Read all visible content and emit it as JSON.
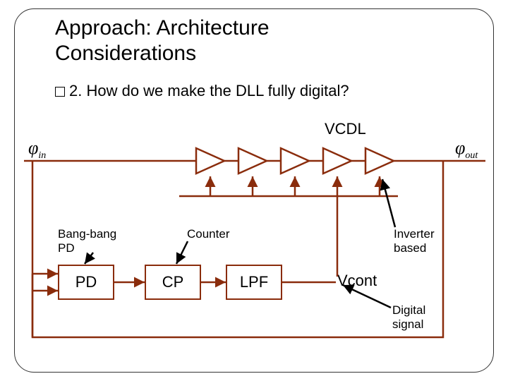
{
  "title_line1": "Approach: Architecture",
  "title_line2": "Considerations",
  "question": "2. How do we make the DLL fully digital?",
  "labels": {
    "vcdl": "VCDL",
    "phi_in": "φ",
    "phi_in_sub": "in",
    "phi_out": "φ",
    "phi_out_sub": "out",
    "bang_bang_pd": "Bang-bang\nPD",
    "counter": "Counter",
    "inverter_based": "Inverter\nbased",
    "vcont": "Vcont",
    "digital_signal": "Digital\nsignal"
  },
  "blocks": {
    "pd": "PD",
    "cp": "CP",
    "lpf": "LPF"
  }
}
